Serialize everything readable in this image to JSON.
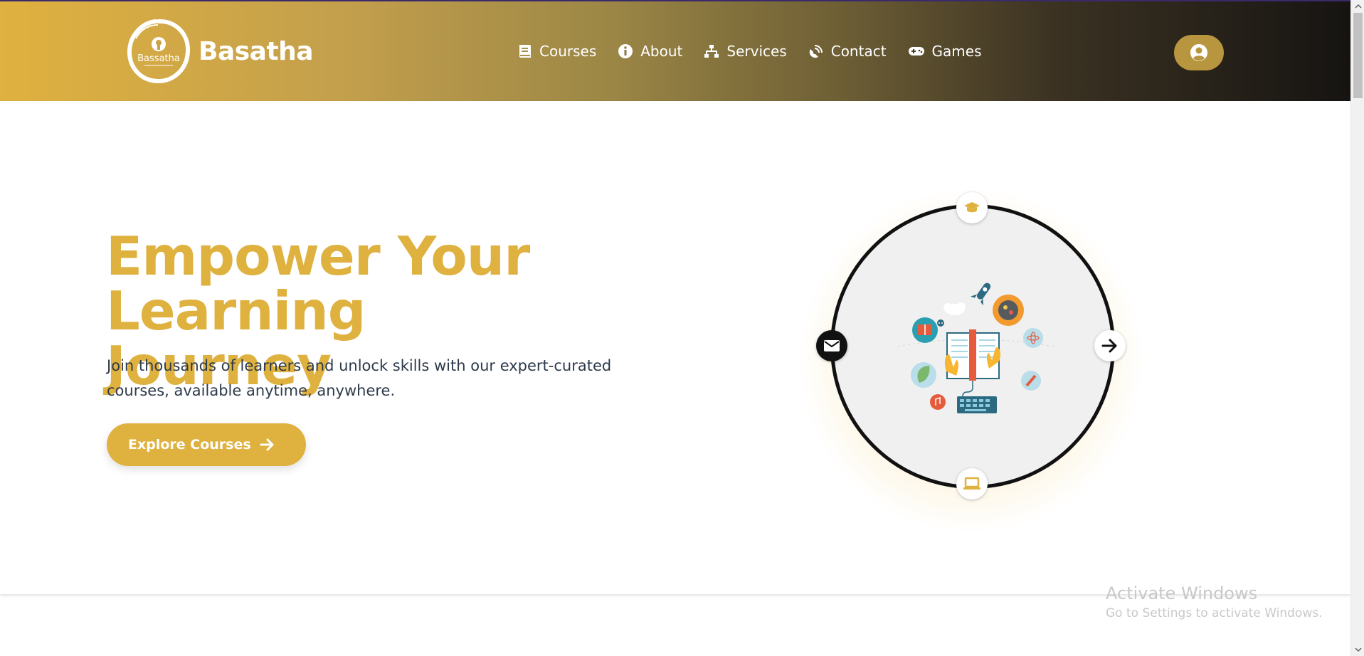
{
  "header": {
    "brand": "Basatha",
    "logo_text": "Bassatha",
    "nav": [
      {
        "label": "Courses",
        "icon": "book-icon"
      },
      {
        "label": "About",
        "icon": "info-icon"
      },
      {
        "label": "Services",
        "icon": "sitemap-icon"
      },
      {
        "label": "Contact",
        "icon": "satellite-dish-icon"
      },
      {
        "label": "Games",
        "icon": "gamepad-icon"
      }
    ],
    "profile_icon": "user-circle-icon"
  },
  "hero": {
    "title_line1": "Empower Your",
    "title_line2": "Learning Journey",
    "subtitle": "Join thousands of learners and unlock skills with our expert-curated courses, available anytime, anywhere.",
    "cta_label": "Explore Courses",
    "orbit_icons": [
      "graduation-cap-icon",
      "envelope-icon",
      "arrow-right-icon",
      "laptop-icon"
    ]
  },
  "watermark": {
    "title": "Activate Windows",
    "subtitle": "Go to Settings to activate Windows."
  },
  "colors": {
    "accent": "#dfb13f",
    "header_dark": "#161412",
    "text_dark": "#2c3a4a"
  }
}
